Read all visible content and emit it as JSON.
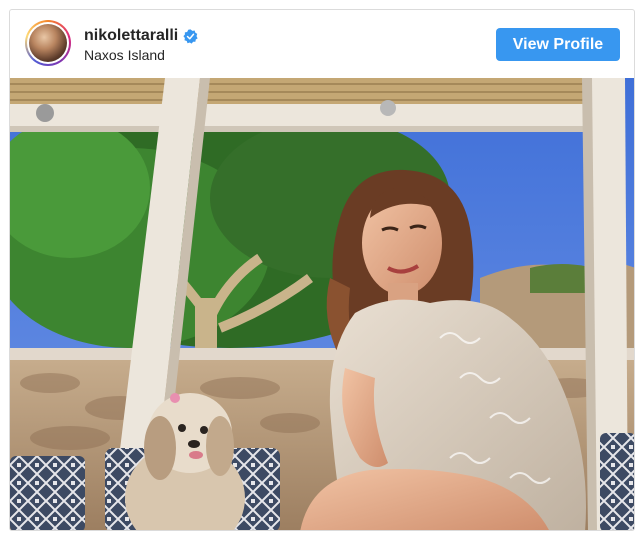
{
  "post": {
    "username": "nikolettaralli",
    "verified": true,
    "location": "Naxos Island",
    "view_profile_label": "View Profile"
  },
  "icons": {
    "avatar": "profile-photo",
    "verified": "verified-badge-icon"
  },
  "colors": {
    "button": "#3897f0",
    "verified": "#3897f0",
    "text": "#262626",
    "border": "#dbdbdb"
  }
}
